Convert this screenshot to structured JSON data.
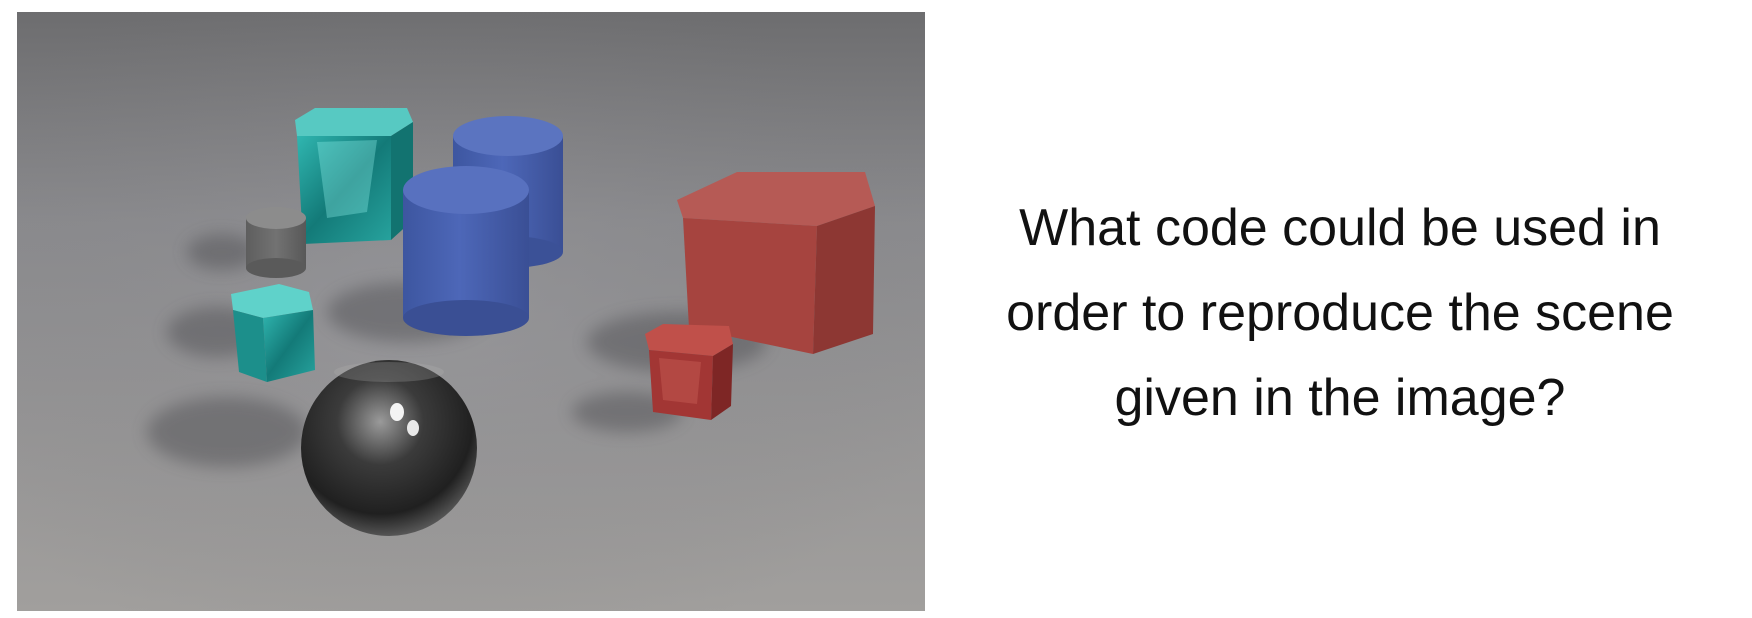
{
  "question": {
    "line1": "What code could be used in",
    "line2": "order to reproduce the scene",
    "line3": "given in the image?"
  },
  "scene": {
    "objects": [
      {
        "name": "large-cyan-metal-cube",
        "shape": "cube",
        "color": "#1f9e9a",
        "material": "metal",
        "size": "large"
      },
      {
        "name": "small-gray-rubber-cylinder",
        "shape": "cylinder",
        "color": "#6c6c6c",
        "material": "rubber",
        "size": "small"
      },
      {
        "name": "large-blue-rubber-cylinder-back",
        "shape": "cylinder",
        "color": "#4a64b4",
        "material": "rubber",
        "size": "large"
      },
      {
        "name": "large-blue-rubber-cylinder-front",
        "shape": "cylinder",
        "color": "#4760b2",
        "material": "rubber",
        "size": "large"
      },
      {
        "name": "small-cyan-metal-cube",
        "shape": "cube",
        "color": "#2aa8a4",
        "material": "metal",
        "size": "small"
      },
      {
        "name": "large-red-rubber-cube",
        "shape": "cube",
        "color": "#a54440",
        "material": "rubber",
        "size": "large"
      },
      {
        "name": "small-red-metal-cube",
        "shape": "cube",
        "color": "#a83a3a",
        "material": "metal",
        "size": "small"
      },
      {
        "name": "large-gray-metal-sphere",
        "shape": "sphere",
        "color": "#3a3a3a",
        "material": "metal",
        "size": "large"
      }
    ]
  }
}
